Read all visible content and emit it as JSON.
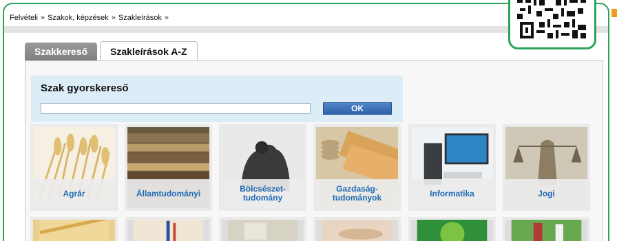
{
  "breadcrumb": [
    {
      "label": "Felvételi"
    },
    {
      "label": "Szakok, képzések"
    },
    {
      "label": "Szakleírások"
    }
  ],
  "breadcrumb_separator": "»",
  "tabs": [
    {
      "label": "Szakkereső",
      "active": false
    },
    {
      "label": "Szakleírások A-Z",
      "active": true
    }
  ],
  "search": {
    "title": "Szak gyorskereső",
    "input_value": "",
    "ok_label": "OK"
  },
  "tiles_row1": [
    {
      "label": "Agrár"
    },
    {
      "label": "Államtudományi"
    },
    {
      "label": "Bölcsészet-\ntudomány"
    },
    {
      "label": "Gazdaság-\ntudományok"
    },
    {
      "label": "Informatika"
    },
    {
      "label": "Jogi"
    }
  ],
  "colors": {
    "frame_green": "#2aa35a",
    "tile_label_blue": "#1f6bb5",
    "ok_blue": "#2e63a8",
    "search_bg": "#dcedf8"
  }
}
